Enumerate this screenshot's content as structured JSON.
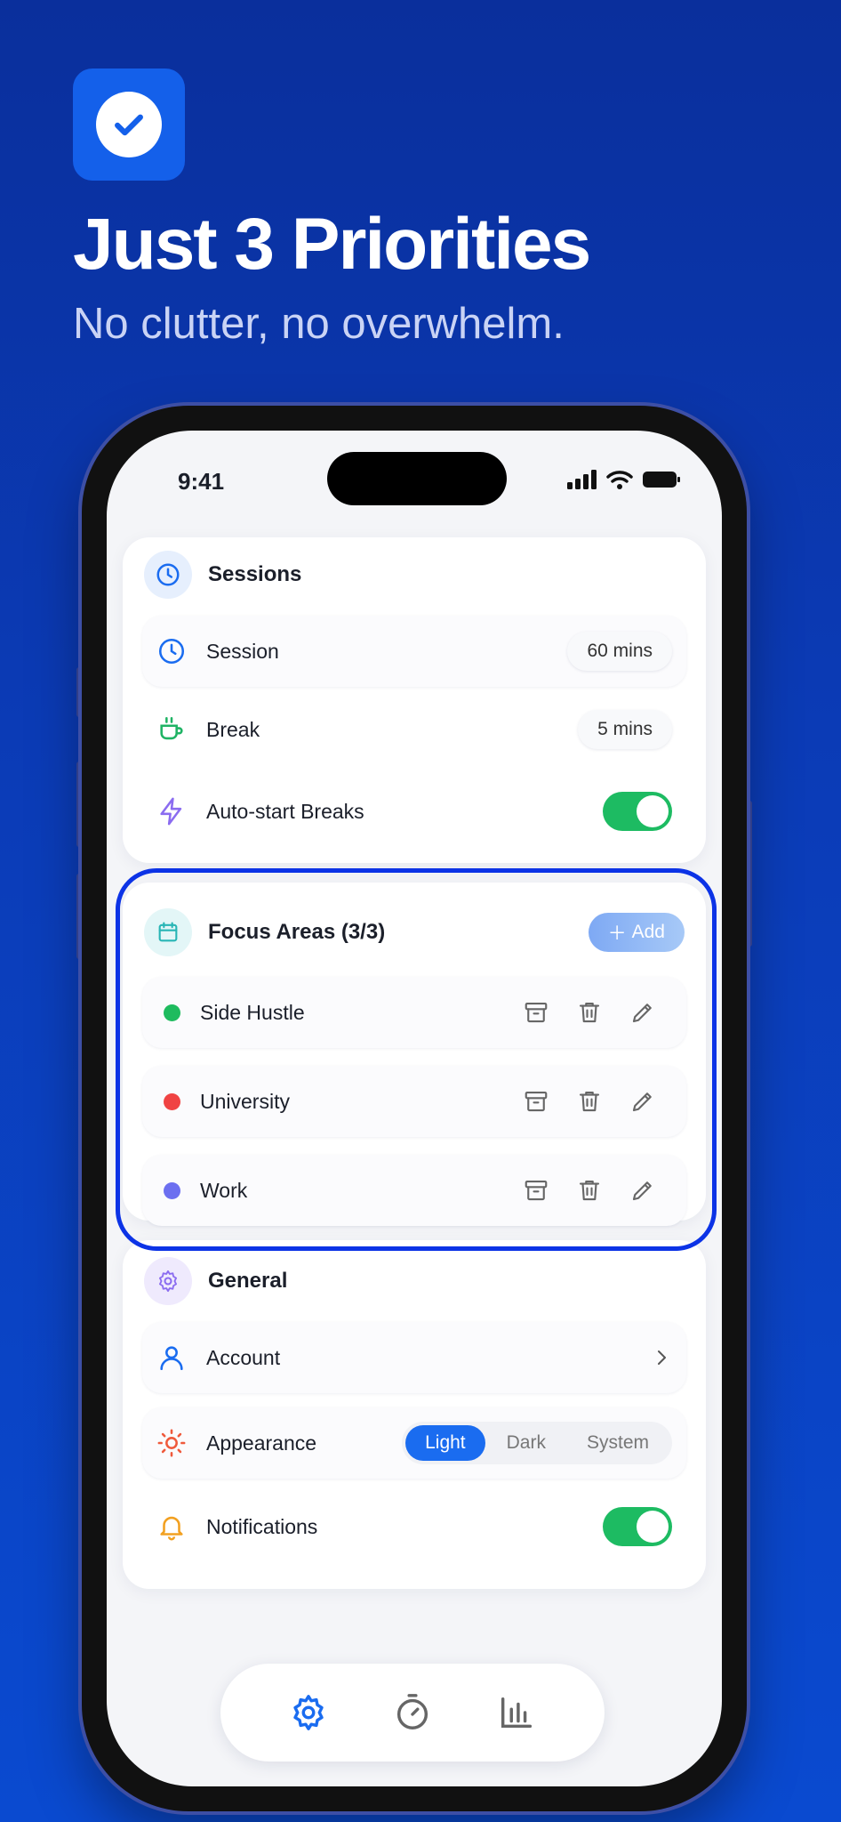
{
  "hero": {
    "title": "Just 3 Priorities",
    "subtitle": "No clutter, no overwhelm."
  },
  "status_bar": {
    "time": "9:41"
  },
  "sessions": {
    "title": "Sessions",
    "session": {
      "label": "Session",
      "value": "60 mins"
    },
    "break": {
      "label": "Break",
      "value": "5 mins"
    },
    "auto_start": {
      "label": "Auto-start Breaks",
      "enabled": true
    }
  },
  "focus_areas": {
    "title": "Focus Areas (3/3)",
    "add_label": "Add",
    "items": [
      {
        "label": "Side Hustle",
        "color": "#1ebb5e"
      },
      {
        "label": "University",
        "color": "#f04343"
      },
      {
        "label": "Work",
        "color": "#6c6ff0"
      }
    ]
  },
  "general": {
    "title": "General",
    "account": {
      "label": "Account"
    },
    "appearance": {
      "label": "Appearance",
      "options": [
        "Light",
        "Dark",
        "System"
      ],
      "selected": "Light"
    },
    "notifications": {
      "label": "Notifications",
      "enabled": true
    }
  },
  "tabs": [
    "settings-icon",
    "timer-icon",
    "stats-icon"
  ],
  "colors": {
    "accent": "#1a6cf0",
    "toggle_on": "#1dbb62",
    "highlight": "#0c33e6"
  }
}
